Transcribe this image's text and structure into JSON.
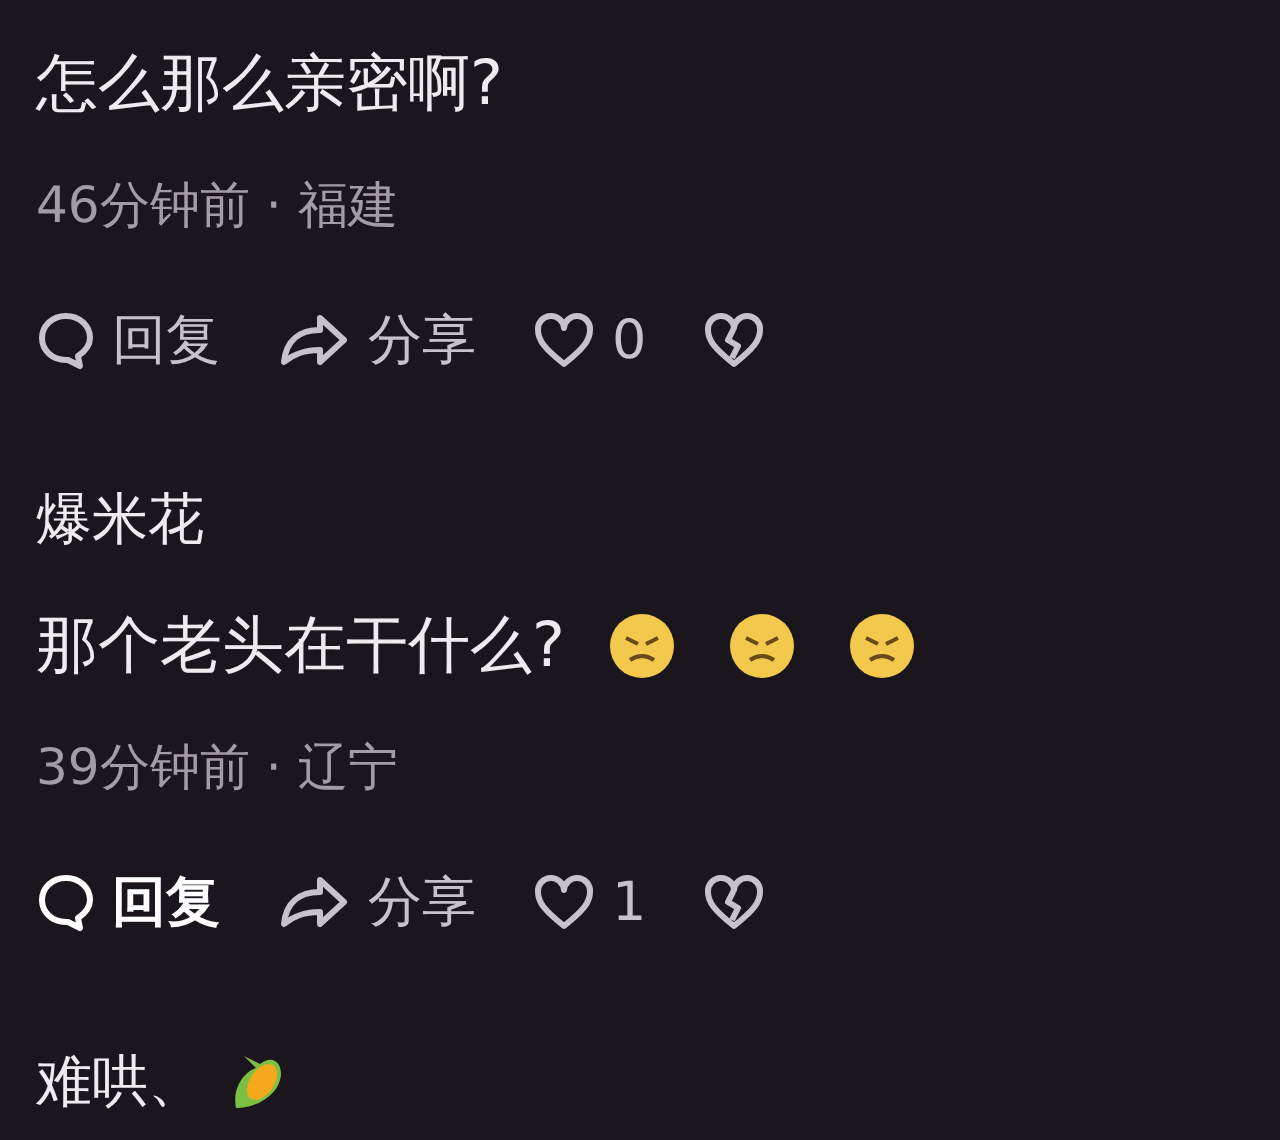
{
  "comments": [
    {
      "text": "怎么那么亲密啊?",
      "time": "46分钟前",
      "location": "福建",
      "separator": "·",
      "actions": {
        "reply": {
          "label": "回复",
          "highlighted": false
        },
        "share": {
          "label": "分享"
        },
        "likes": "0"
      }
    },
    {
      "username": "爆米花",
      "text": "那个老头在干什么?",
      "emojis": [
        {
          "kind": "angry"
        },
        {
          "kind": "angry"
        },
        {
          "kind": "angry"
        }
      ],
      "time": "39分钟前",
      "location": "辽宁",
      "separator": "·",
      "actions": {
        "reply": {
          "label": "回复",
          "highlighted": true
        },
        "share": {
          "label": "分享"
        },
        "likes": "1"
      }
    },
    {
      "username": "难哄、",
      "badge": {
        "kind": "corn"
      }
    }
  ]
}
